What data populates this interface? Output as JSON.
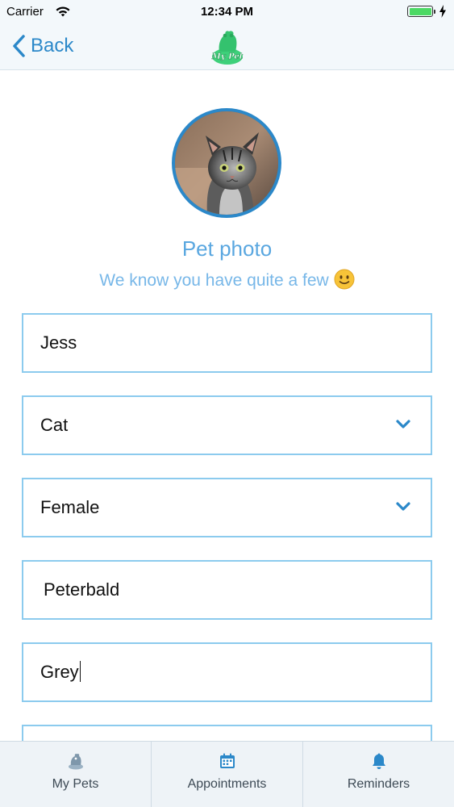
{
  "status_bar": {
    "carrier": "Carrier",
    "time": "12:34 PM",
    "battery_level": 1.0
  },
  "nav": {
    "back_label": "Back",
    "logo_text": "My Pet"
  },
  "photo": {
    "title": "Pet photo",
    "subtitle": "We know you have quite a few",
    "emoji_icon": "slightly-smiling-face-icon"
  },
  "form": {
    "name": "Jess",
    "species": "Cat",
    "gender": "Female",
    "breed": "Peterbald",
    "color": "Grey",
    "next_field": ""
  },
  "tabs": [
    {
      "label": "My Pets",
      "icon": "pet-icon"
    },
    {
      "label": "Appointments",
      "icon": "calendar-icon"
    },
    {
      "label": "Reminders",
      "icon": "bell-icon"
    }
  ],
  "colors": {
    "accent": "#2b88c9",
    "field_border": "#8ccbee",
    "title_text": "#5aa7e0",
    "battery": "#4cd964"
  }
}
